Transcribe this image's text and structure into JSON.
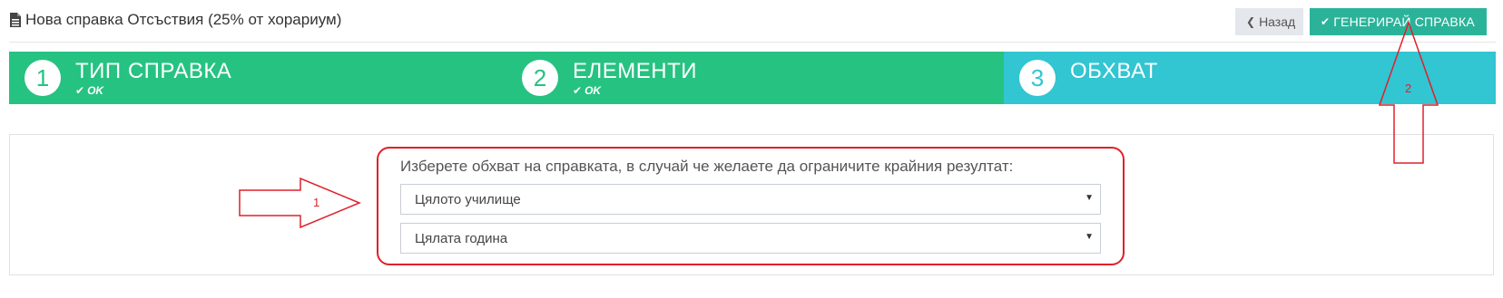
{
  "header": {
    "title": "Нова справка Отсъствия (25% от хорариум)",
    "back_label": "Назад",
    "generate_label": "ГЕНЕРИРАЙ СПРАВКА"
  },
  "wizard": {
    "steps": [
      {
        "number": "1",
        "label": "ТИП СПРАВКА",
        "status": "OK"
      },
      {
        "number": "2",
        "label": "ЕЛЕМЕНТИ",
        "status": "OK"
      },
      {
        "number": "3",
        "label": "ОБХВАТ",
        "status": ""
      }
    ]
  },
  "scope": {
    "prompt": "Изберете обхват на справката, в случай че желаете да ограничите крайния резултат:",
    "school_select": "Цялото училище",
    "period_select": "Цялата година"
  },
  "annotations": {
    "arrow1": "1",
    "arrow2": "2"
  },
  "colors": {
    "step_done": "#26c281",
    "step_active": "#32c5d2",
    "generate_button": "#2bb39a",
    "annotation": "#e0202a"
  }
}
